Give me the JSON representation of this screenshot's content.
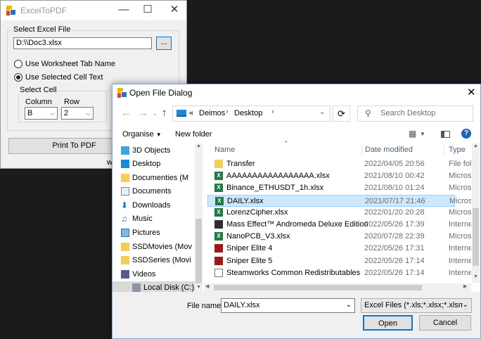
{
  "excel_window": {
    "title": "ExcelToPDF",
    "select_file_label": "Select Excel File",
    "file_path": "D:\\\\Doc3.xlsx",
    "browse_label": "...",
    "radio_tab_name": "Use Worksheet Tab Name",
    "radio_cell_text": "Use Selected Cell Text",
    "select_cell_label": "Select Cell",
    "column_label": "Column",
    "row_label": "Row",
    "column_value": "B",
    "row_value": "2",
    "print_label": "Print To PDF",
    "cut_text": "w"
  },
  "dialog": {
    "title": "Open File Dialog",
    "breadcrumb_prefix": "«",
    "breadcrumb": [
      "Deimos",
      "Desktop"
    ],
    "search_placeholder": "Search Desktop",
    "organise_label": "Organise",
    "new_folder_label": "New folder",
    "columns": {
      "name": "Name",
      "date": "Date modified",
      "type": "Type"
    },
    "nav_items": [
      {
        "label": "3D Objects",
        "icon": "cube-icon"
      },
      {
        "label": "Desktop",
        "icon": "desktop-icon"
      },
      {
        "label": "Documenties (M",
        "icon": "folder-icon"
      },
      {
        "label": "Documents",
        "icon": "documents-icon"
      },
      {
        "label": "Downloads",
        "icon": "download-icon"
      },
      {
        "label": "Music",
        "icon": "music-icon"
      },
      {
        "label": "Pictures",
        "icon": "pictures-icon"
      },
      {
        "label": "SSDMovies (Mov",
        "icon": "folder-icon"
      },
      {
        "label": "SSDSeries (Movi",
        "icon": "folder-icon"
      },
      {
        "label": "Videos",
        "icon": "videos-icon"
      },
      {
        "label": "Local Disk (C:)",
        "icon": "drive-icon"
      }
    ],
    "files": [
      {
        "name": "Transfer",
        "date": "2022/04/05 20:56",
        "type": "File fold",
        "icon": "folder-icon"
      },
      {
        "name": "AAAAAAAAAAAAAAAAA.xlsx",
        "date": "2021/08/10 00:42",
        "type": "Microso",
        "icon": "excel-icon"
      },
      {
        "name": "Binance_ETHUSDT_1h.xlsx",
        "date": "2021/08/10 01:24",
        "type": "Microso",
        "icon": "excel-icon"
      },
      {
        "name": "DAILY.xlsx",
        "date": "2021/07/17 21:46",
        "type": "Microso",
        "icon": "excel-icon"
      },
      {
        "name": "LorenzCipher.xlsx",
        "date": "2022/01/20 20:28",
        "type": "Microso",
        "icon": "excel-icon"
      },
      {
        "name": "Mass Effect™ Andromeda Deluxe Edition",
        "date": "2022/05/26 17:39",
        "type": "Interne",
        "icon": "game-icon"
      },
      {
        "name": "NanoPCB_V3.xlsx",
        "date": "2020/07/28 22:39",
        "type": "Microso",
        "icon": "excel-icon"
      },
      {
        "name": "Sniper Elite 4",
        "date": "2022/05/26 17:31",
        "type": "Interne",
        "icon": "game-icon"
      },
      {
        "name": "Sniper Elite 5",
        "date": "2022/05/26 17:14",
        "type": "Interne",
        "icon": "game-icon"
      },
      {
        "name": "Steamworks Common Redistributables",
        "date": "2022/05/26 17:14",
        "type": "Interne",
        "icon": "steam-icon"
      }
    ],
    "selected_index": 3,
    "file_name_label": "File name:",
    "file_name_value": "DAILY.xlsx",
    "filter_value": "Excel Files (*.xls;*.xlsx;*.xlsm)",
    "open_label": "Open",
    "cancel_label": "Cancel"
  },
  "colors": {
    "accent": "#0078d7",
    "selection": "#cce8ff",
    "title_inactive": "#999999"
  }
}
